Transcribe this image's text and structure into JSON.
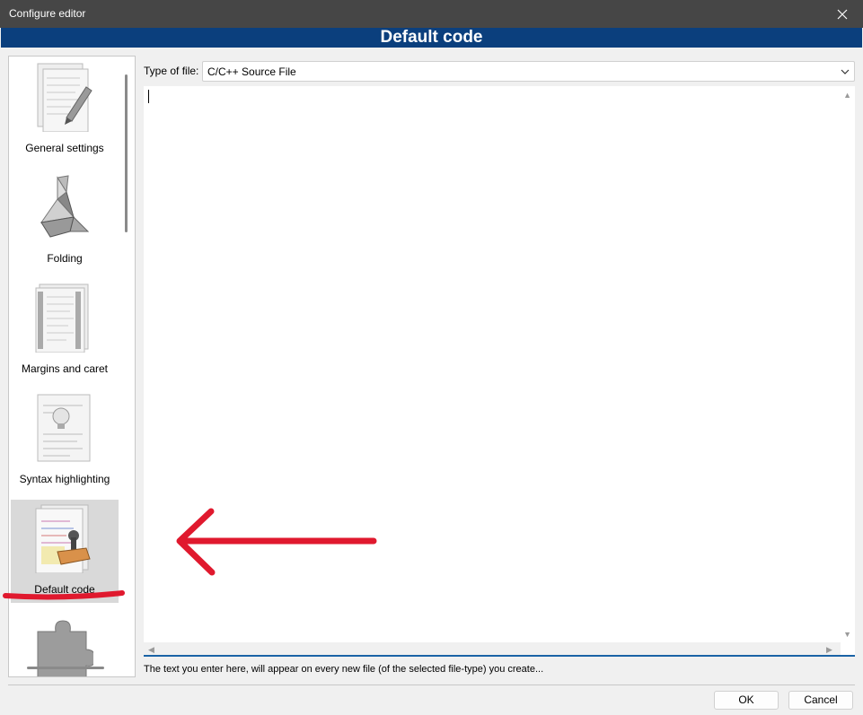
{
  "window": {
    "title": "Configure editor",
    "close_icon": "close-icon"
  },
  "banner": {
    "title": "Default code"
  },
  "sidebar": {
    "items": [
      {
        "label": "General settings",
        "icon": "pencil-document-icon"
      },
      {
        "label": "Folding",
        "icon": "origami-bird-icon"
      },
      {
        "label": "Margins and caret",
        "icon": "ruled-document-icon"
      },
      {
        "label": "Syntax highlighting",
        "icon": "bulb-document-icon"
      },
      {
        "label": "Default code",
        "icon": "stamp-document-icon",
        "selected": true
      },
      {
        "label": "",
        "icon": "puzzle-piece-icon"
      }
    ]
  },
  "file_type": {
    "label": "Type of file:",
    "value": "C/C++ Source File"
  },
  "editor": {
    "content": ""
  },
  "hint": "The text you enter here, will appear on every new file (of the selected file-type) you create...",
  "buttons": {
    "ok": "OK",
    "cancel": "Cancel"
  },
  "colors": {
    "banner": "#0b3f7d",
    "titlebar": "#464646",
    "annotation": "#e0192e",
    "accent_line": "#1a63a6"
  }
}
